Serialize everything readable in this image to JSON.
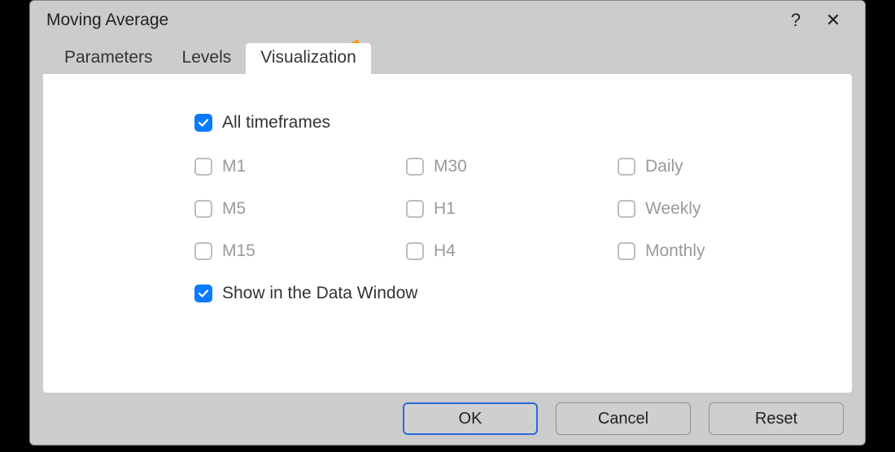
{
  "window": {
    "title": "Moving Average",
    "help_glyph": "?",
    "close_glyph": "✕"
  },
  "tabs": {
    "parameters": "Parameters",
    "levels": "Levels",
    "visualization": "Visualization"
  },
  "viz": {
    "all_timeframes": "All timeframes",
    "m1": "M1",
    "m5": "M5",
    "m15": "M15",
    "m30": "M30",
    "h1": "H1",
    "h4": "H4",
    "daily": "Daily",
    "weekly": "Weekly",
    "monthly": "Monthly",
    "show_data_window": "Show in the Data Window"
  },
  "buttons": {
    "ok": "OK",
    "cancel": "Cancel",
    "reset": "Reset"
  }
}
